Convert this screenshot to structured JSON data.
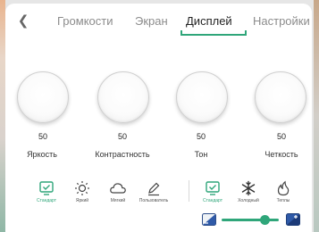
{
  "tabs": {
    "back_icon": "chevron-left-icon",
    "items": [
      {
        "label": "Громкости"
      },
      {
        "label": "Экран"
      },
      {
        "label": "Дисплей",
        "active": true
      },
      {
        "label": "Настройки"
      }
    ]
  },
  "knobs": [
    {
      "value": "50",
      "label": "Яркость"
    },
    {
      "value": "50",
      "label": "Контрастность"
    },
    {
      "value": "50",
      "label": "Тон"
    },
    {
      "value": "50",
      "label": "Четкость"
    }
  ],
  "modes": [
    {
      "label": "Стандарт",
      "icon": "check-monitor-icon",
      "selected": true
    },
    {
      "label": "Яркий",
      "icon": "sun-icon"
    },
    {
      "label": "Мягкий",
      "icon": "cloud-icon"
    },
    {
      "label": "Пользователь",
      "icon": "pen-icon"
    }
  ],
  "temperatures": [
    {
      "label": "Стандарт",
      "icon": "check-monitor-icon",
      "selected": true
    },
    {
      "label": "Холодный",
      "icon": "snowflake-icon"
    },
    {
      "label": "Теплы",
      "icon": "flame-icon"
    }
  ],
  "blue_light_slider": {
    "left_icon": "eye-care-low-icon",
    "right_icon": "eye-care-high-icon",
    "level": 0.75
  },
  "colors": {
    "accent": "#2fa67a",
    "text": "#222222",
    "muted": "#8c8c8c"
  }
}
